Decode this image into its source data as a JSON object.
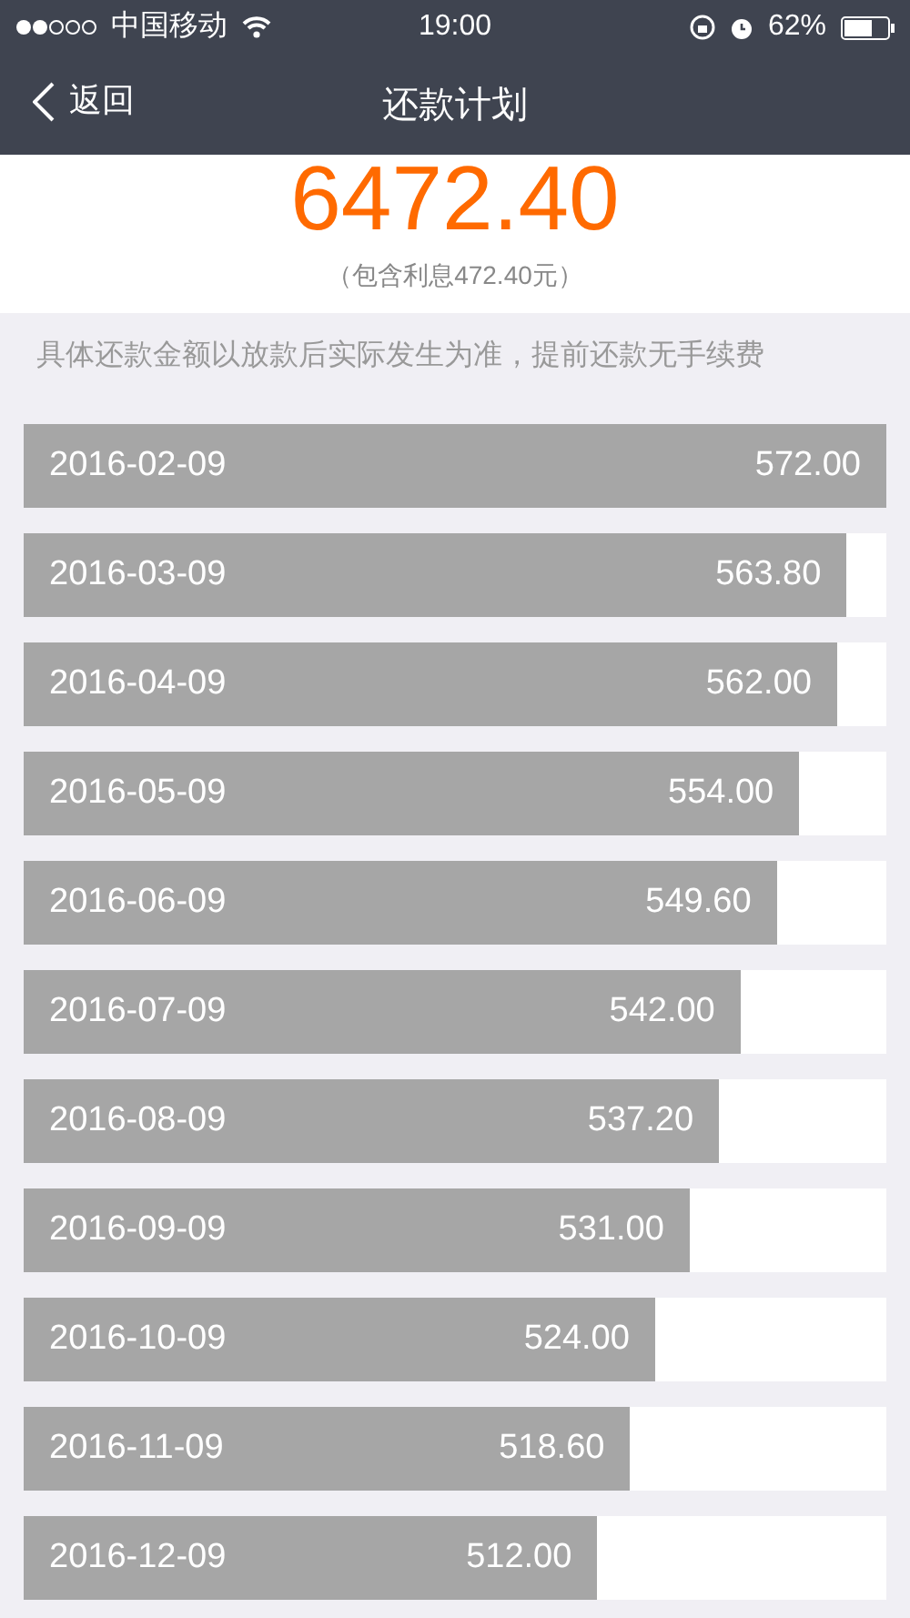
{
  "status_bar": {
    "carrier": "中国移动",
    "time": "19:00",
    "battery": "62%"
  },
  "nav": {
    "back": "返回",
    "title": "还款计划"
  },
  "summary": {
    "total": "6472.40",
    "interest": "（包含利息472.40元）"
  },
  "note": "具体还款金额以放款后实际发生为准，提前还款无手续费",
  "schedule": [
    {
      "date": "2016-02-09",
      "amount": "572.00",
      "level": 1
    },
    {
      "date": "2016-03-09",
      "amount": "563.80",
      "level": 0.954
    },
    {
      "date": "2016-04-09",
      "amount": "562.00",
      "level": 0.943
    },
    {
      "date": "2016-05-09",
      "amount": "554.00",
      "level": 0.899
    },
    {
      "date": "2016-06-09",
      "amount": "549.60",
      "level": 0.873
    },
    {
      "date": "2016-07-09",
      "amount": "542.00",
      "level": 0.831
    },
    {
      "date": "2016-08-09",
      "amount": "537.20",
      "level": 0.806
    },
    {
      "date": "2016-09-09",
      "amount": "531.00",
      "level": 0.772
    },
    {
      "date": "2016-10-09",
      "amount": "524.00",
      "level": 0.732
    },
    {
      "date": "2016-11-09",
      "amount": "518.60",
      "level": 0.703
    },
    {
      "date": "2016-12-09",
      "amount": "512.00",
      "level": 0.665
    }
  ]
}
